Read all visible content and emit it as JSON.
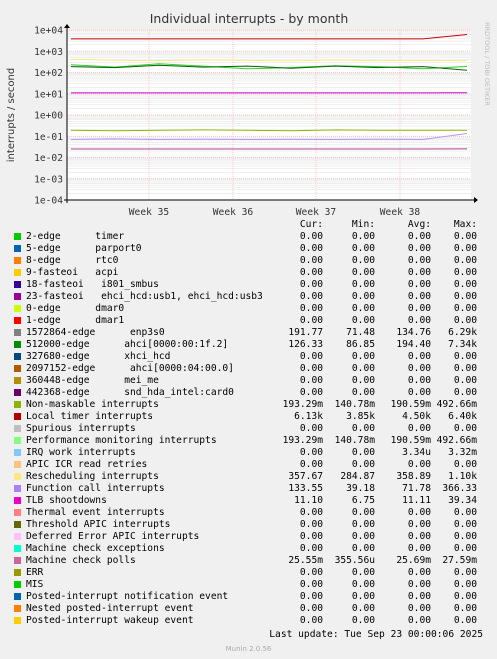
{
  "chart_data": {
    "type": "line",
    "title": "Individual interrupts - by month",
    "ylabel": "interrupts / second",
    "yscale": "log",
    "ylim": [
      0.0001,
      10000
    ],
    "ytick_labels": [
      "1e-04",
      "1e-03",
      "1e-02",
      "1e-01",
      "1e+00",
      "1e+01",
      "1e+02",
      "1e+03",
      "1e+04"
    ],
    "ytick_values": [
      0.0001,
      0.001,
      0.01,
      0.1,
      1,
      10,
      100,
      1000,
      10000
    ],
    "x_tick_labels": [
      "Week 35",
      "Week 36",
      "Week 37",
      "Week 38"
    ],
    "grid": true,
    "side_label": "RRDTOOL / TOBI OETIKER",
    "series": [
      {
        "name": "Local timer interrupts",
        "color": "#CC0000",
        "values": [
          3800,
          3800,
          3800,
          3800,
          3800,
          3800,
          3800,
          3800,
          3800,
          6130
        ]
      },
      {
        "name": "Rescheduling interrupts",
        "color": "#FFE680",
        "values": [
          420,
          380,
          360,
          400,
          370,
          350,
          390,
          360,
          380,
          357.67
        ]
      },
      {
        "name": "1572864-edge enp3s0",
        "color": "#33CC33",
        "values": [
          230,
          180,
          260,
          200,
          150,
          170,
          210,
          190,
          150,
          191.77
        ]
      },
      {
        "name": "512000-edge ahci[0000:00:1f.2]",
        "color": "#006600",
        "values": [
          190,
          170,
          220,
          180,
          200,
          160,
          200,
          170,
          190,
          126.33
        ]
      },
      {
        "name": "Non-maskable interrupts",
        "color": "#8FB300",
        "values": [
          0.19,
          0.18,
          0.19,
          0.2,
          0.19,
          0.18,
          0.2,
          0.19,
          0.19,
          0.193
        ]
      },
      {
        "name": "Function call interrupts",
        "color": "#B399FF",
        "values": [
          0.07,
          0.075,
          0.07,
          0.072,
          0.07,
          0.071,
          0.07,
          0.072,
          0.07,
          0.134
        ]
      },
      {
        "name": "TLB shootdowns",
        "color": "#CC00CC",
        "values": [
          11,
          11,
          11,
          11,
          11,
          11,
          11,
          11,
          11,
          11.1
        ]
      },
      {
        "name": "Machine check polls",
        "color": "#AA4488",
        "values": [
          0.025,
          0.025,
          0.025,
          0.025,
          0.025,
          0.025,
          0.025,
          0.025,
          0.025,
          0.0255
        ]
      }
    ]
  },
  "legend": {
    "headers": {
      "cur": "Cur:",
      "min": "Min:",
      "avg": "Avg:",
      "max": "Max:"
    },
    "rows": [
      {
        "name": "2-edge      timer",
        "color": "#00CC00",
        "cur": "0.00",
        "min": "0.00",
        "avg": "0.00",
        "max": "0.00"
      },
      {
        "name": "5-edge      parport0",
        "color": "#0066B3",
        "cur": "0.00",
        "min": "0.00",
        "avg": "0.00",
        "max": "0.00"
      },
      {
        "name": "8-edge      rtc0",
        "color": "#FF8000",
        "cur": "0.00",
        "min": "0.00",
        "avg": "0.00",
        "max": "0.00"
      },
      {
        "name": "9-fasteoi   acpi",
        "color": "#FFCC00",
        "cur": "0.00",
        "min": "0.00",
        "avg": "0.00",
        "max": "0.00"
      },
      {
        "name": "18-fasteoi   i801_smbus",
        "color": "#330099",
        "cur": "0.00",
        "min": "0.00",
        "avg": "0.00",
        "max": "0.00"
      },
      {
        "name": "23-fasteoi   ehci_hcd:usb1, ehci_hcd:usb3",
        "color": "#990099",
        "cur": "0.00",
        "min": "0.00",
        "avg": "0.00",
        "max": "0.00"
      },
      {
        "name": "0-edge      dmar0",
        "color": "#CCFF00",
        "cur": "0.00",
        "min": "0.00",
        "avg": "0.00",
        "max": "0.00"
      },
      {
        "name": "1-edge      dmar1",
        "color": "#FF0000",
        "cur": "0.00",
        "min": "0.00",
        "avg": "0.00",
        "max": "0.00"
      },
      {
        "name": "1572864-edge      enp3s0",
        "color": "#808080",
        "cur": "191.77",
        "min": "71.48",
        "avg": "134.76",
        "max": "6.29k"
      },
      {
        "name": "512000-edge      ahci[0000:00:1f.2]",
        "color": "#008F00",
        "cur": "126.33",
        "min": "86.85",
        "avg": "194.40",
        "max": "7.34k"
      },
      {
        "name": "327680-edge      xhci_hcd",
        "color": "#00487D",
        "cur": "0.00",
        "min": "0.00",
        "avg": "0.00",
        "max": "0.00"
      },
      {
        "name": "2097152-edge      ahci[0000:04:00.0]",
        "color": "#B35A00",
        "cur": "0.00",
        "min": "0.00",
        "avg": "0.00",
        "max": "0.00"
      },
      {
        "name": "360448-edge      mei_me",
        "color": "#B38F00",
        "cur": "0.00",
        "min": "0.00",
        "avg": "0.00",
        "max": "0.00"
      },
      {
        "name": "442368-edge      snd_hda_intel:card0",
        "color": "#6B006B",
        "cur": "0.00",
        "min": "0.00",
        "avg": "0.00",
        "max": "0.00"
      },
      {
        "name": "Non-maskable interrupts",
        "color": "#8FB300",
        "cur": "193.29m",
        "min": "140.78m",
        "avg": "190.59m",
        "max": "492.66m"
      },
      {
        "name": "Local timer interrupts",
        "color": "#B30000",
        "cur": "6.13k",
        "min": "3.85k",
        "avg": "4.50k",
        "max": "6.40k"
      },
      {
        "name": "Spurious interrupts",
        "color": "#BEBEBE",
        "cur": "0.00",
        "min": "0.00",
        "avg": "0.00",
        "max": "0.00"
      },
      {
        "name": "Performance monitoring interrupts",
        "color": "#80FF80",
        "cur": "193.29m",
        "min": "140.78m",
        "avg": "190.59m",
        "max": "492.66m"
      },
      {
        "name": "IRQ work interrupts",
        "color": "#80C9FF",
        "cur": "0.00",
        "min": "0.00",
        "avg": "3.34u",
        "max": "3.32m"
      },
      {
        "name": "APIC ICR read retries",
        "color": "#FFC080",
        "cur": "0.00",
        "min": "0.00",
        "avg": "0.00",
        "max": "0.00"
      },
      {
        "name": "Rescheduling interrupts",
        "color": "#FFE680",
        "cur": "357.67",
        "min": "284.87",
        "avg": "358.89",
        "max": "1.10k"
      },
      {
        "name": "Function call interrupts",
        "color": "#AA80FF",
        "cur": "133.55",
        "min": "39.18",
        "avg": "71.78",
        "max": "366.33"
      },
      {
        "name": "TLB shootdowns",
        "color": "#EE00CC",
        "cur": "11.10",
        "min": "6.75",
        "avg": "11.11",
        "max": "39.34"
      },
      {
        "name": "Thermal event interrupts",
        "color": "#FF8080",
        "cur": "0.00",
        "min": "0.00",
        "avg": "0.00",
        "max": "0.00"
      },
      {
        "name": "Threshold APIC interrupts",
        "color": "#666600",
        "cur": "0.00",
        "min": "0.00",
        "avg": "0.00",
        "max": "0.00"
      },
      {
        "name": "Deferred Error APIC interrupts",
        "color": "#FFBFFF",
        "cur": "0.00",
        "min": "0.00",
        "avg": "0.00",
        "max": "0.00"
      },
      {
        "name": "Machine check exceptions",
        "color": "#00FFCC",
        "cur": "0.00",
        "min": "0.00",
        "avg": "0.00",
        "max": "0.00"
      },
      {
        "name": "Machine check polls",
        "color": "#CC6699",
        "cur": "25.55m",
        "min": "355.56u",
        "avg": "25.69m",
        "max": "27.59m"
      },
      {
        "name": "ERR",
        "color": "#999900",
        "cur": "0.00",
        "min": "0.00",
        "avg": "0.00",
        "max": "0.00"
      },
      {
        "name": "MIS",
        "color": "#00CC00",
        "cur": "0.00",
        "min": "0.00",
        "avg": "0.00",
        "max": "0.00"
      },
      {
        "name": "Posted-interrupt notification event",
        "color": "#0066B3",
        "cur": "0.00",
        "min": "0.00",
        "avg": "0.00",
        "max": "0.00"
      },
      {
        "name": "Nested posted-interrupt event",
        "color": "#FF8000",
        "cur": "0.00",
        "min": "0.00",
        "avg": "0.00",
        "max": "0.00"
      },
      {
        "name": "Posted-interrupt wakeup event",
        "color": "#FFCC00",
        "cur": "0.00",
        "min": "0.00",
        "avg": "0.00",
        "max": "0.00"
      }
    ]
  },
  "footer": {
    "last_update": "Last update: Tue Sep 23 00:00:06 2025",
    "version": "Munin 2.0.56"
  }
}
